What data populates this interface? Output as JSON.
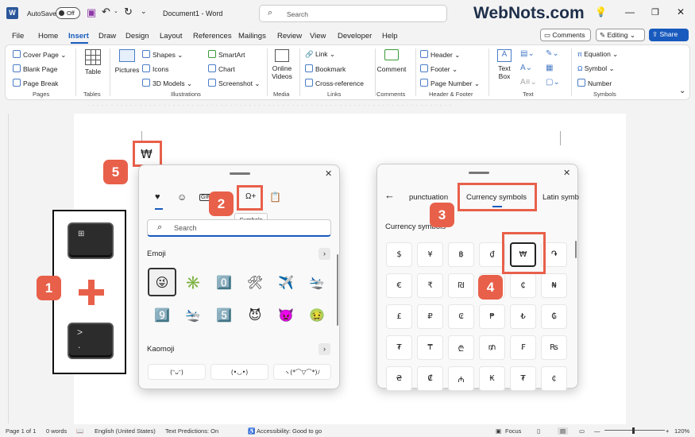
{
  "titlebar": {
    "autosave_label": "AutoSave",
    "autosave_state": "Off",
    "doc_title": "Document1 - Word",
    "search_placeholder": "Search",
    "watermark": "WebNots.com"
  },
  "menu": [
    "File",
    "Home",
    "Insert",
    "Draw",
    "Design",
    "Layout",
    "References",
    "Mailings",
    "Review",
    "View",
    "Developer",
    "Help"
  ],
  "menu_right": {
    "comments": "Comments",
    "editing": "Editing",
    "share": "Share"
  },
  "ribbon": {
    "pages": {
      "items": [
        "Cover Page",
        "Blank Page",
        "Page Break"
      ],
      "label": "Pages"
    },
    "tables": {
      "items": [
        "Table"
      ],
      "label": "Tables"
    },
    "illustrations": {
      "items": [
        "Pictures",
        "Shapes",
        "Icons",
        "3D Models",
        "SmartArt",
        "Chart",
        "Screenshot"
      ],
      "label": "Illustrations"
    },
    "media": {
      "items": [
        "Online",
        "Videos"
      ],
      "label": "Media"
    },
    "links": {
      "items": [
        "Link",
        "Bookmark",
        "Cross-reference"
      ],
      "label": "Links"
    },
    "comments": {
      "items": [
        "Comment"
      ],
      "label": "Comments"
    },
    "header_footer": {
      "items": [
        "Header",
        "Footer",
        "Page Number"
      ],
      "label": "Header & Footer"
    },
    "text": {
      "items": [
        "Text",
        "Box"
      ],
      "label": "Text"
    },
    "symbols": {
      "items": [
        "Equation",
        "Symbol",
        "Number"
      ],
      "label": "Symbols"
    }
  },
  "document": {
    "inserted_symbol": "₩"
  },
  "emoji_panel": {
    "tooltip": "Symbols",
    "search_placeholder": "Search",
    "emoji_heading": "Emoji",
    "kaomoji_heading": "Kaomoji",
    "emojis": [
      "😜",
      "✳️",
      "0️⃣",
      "🛠",
      "✈️",
      "🛬",
      "9️⃣",
      "🛬",
      "5️⃣",
      "😈",
      "👿",
      "🤢"
    ],
    "kaomoji": [
      "(ᵔᴗᵔ)",
      "(•◡•)",
      "ヽ(*⌒▽⌒*)ﾉ"
    ]
  },
  "symbols_panel": {
    "tabs": [
      "punctuation",
      "Currency symbols",
      "Latin symb"
    ],
    "section_title": "Currency symbols",
    "symbols": [
      "$",
      "¥",
      "฿",
      "₫",
      "₩",
      "֏",
      "€",
      "₹",
      "₪",
      "₮",
      "₵",
      "₦",
      "£",
      "₽",
      "₢",
      "₱",
      "₺",
      "₲",
      "₮",
      "₸",
      "₾",
      "₥",
      "₣",
      "₨",
      "₴",
      "₡",
      "₼",
      "₭",
      "₮",
      "¢"
    ]
  },
  "callouts": [
    "1",
    "2",
    "3",
    "4",
    "5"
  ],
  "statusbar": {
    "page": "Page 1 of 1",
    "words": "0 words",
    "language": "English (United States)",
    "predictions": "Text Predictions: On",
    "accessibility": "Accessibility: Good to go",
    "focus": "Focus",
    "zoom": "120%"
  },
  "colors": {
    "accent": "#185abd",
    "callout": "#e8604a",
    "word_blue": "#2b579a"
  }
}
